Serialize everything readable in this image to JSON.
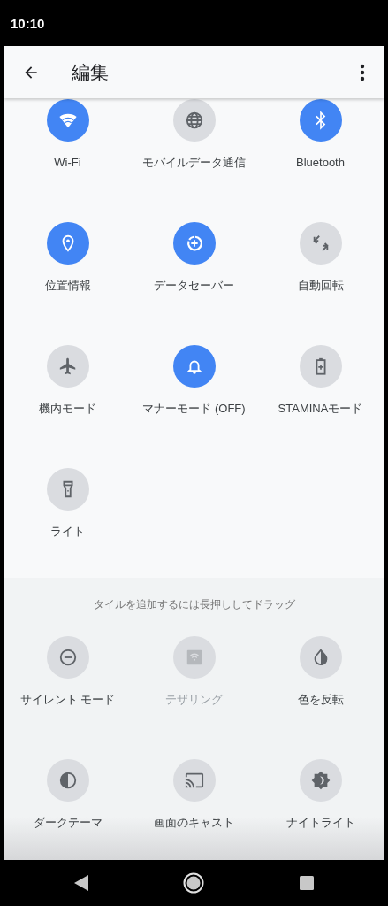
{
  "status_bar": {
    "time": "10:10"
  },
  "header": {
    "title": "編集"
  },
  "active_tiles": [
    {
      "label": "Wi-Fi",
      "on": true
    },
    {
      "label": "モバイルデータ通信",
      "on": false
    },
    {
      "label": "Bluetooth",
      "on": true
    },
    {
      "label": "位置情報",
      "on": true
    },
    {
      "label": "データセーバー",
      "on": true
    },
    {
      "label": "自動回転",
      "on": false
    },
    {
      "label": "機内モード",
      "on": false
    },
    {
      "label": "マナーモード (OFF)",
      "on": true
    },
    {
      "label": "STAMINAモード",
      "on": false
    },
    {
      "label": "ライト",
      "on": false
    }
  ],
  "available_section": {
    "hint": "タイルを追加するには長押ししてドラッグ",
    "tiles": [
      {
        "label": "サイレント モード",
        "disabled": false
      },
      {
        "label": "テザリング",
        "disabled": true
      },
      {
        "label": "色を反転",
        "disabled": false
      },
      {
        "label": "ダークテーマ",
        "disabled": false
      },
      {
        "label": "画面のキャスト",
        "disabled": false
      },
      {
        "label": "ナイトライト",
        "disabled": false
      }
    ]
  }
}
